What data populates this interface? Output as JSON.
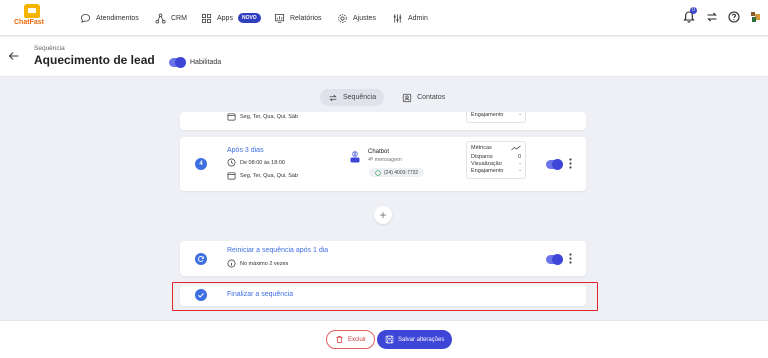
{
  "brand": {
    "name": "ChatFast"
  },
  "nav": {
    "items": [
      {
        "label": "Atendimentos",
        "icon": "chat-bubble-icon"
      },
      {
        "label": "CRM",
        "icon": "network-icon"
      },
      {
        "label": "Apps",
        "icon": "grid-icon",
        "badge": "NOVO"
      },
      {
        "label": "Relatórios",
        "icon": "report-icon"
      },
      {
        "label": "Ajustes",
        "icon": "gear-icon"
      },
      {
        "label": "Admin",
        "icon": "sliders-icon"
      }
    ],
    "notification_count": "0"
  },
  "header": {
    "breadcrumb": "Sequência",
    "title": "Aquecimento de lead",
    "toggle_label": "Habilitada",
    "enabled": true
  },
  "tabs": [
    {
      "label": "Sequência",
      "active": true
    },
    {
      "label": "Contatos",
      "active": false
    }
  ],
  "steps": {
    "partial": {
      "days_text": "Seg, Ter, Qua, Qui, Sáb",
      "metric_label": "Engajamento",
      "metric_value": "-"
    },
    "step4": {
      "number": "4",
      "title": "Após 3 dias",
      "time_text": "De 08:00 às 18:00",
      "days_text": "Seg, Ter, Qua, Qui, Sáb",
      "bot_name": "Chatbot",
      "bot_message": "4ª mensagem",
      "phone": "(24) 4003-7732",
      "metrics": {
        "title": "Métricas",
        "rows": [
          {
            "label": "Disparos",
            "value": "0"
          },
          {
            "label": "Visualização",
            "value": "-"
          },
          {
            "label": "Engajamento",
            "value": "-"
          }
        ]
      },
      "enabled": true
    },
    "restart": {
      "title": "Reiniciar a sequência após 1 dia",
      "limit_text": "No máximo 2 vezes",
      "enabled": true
    },
    "finish": {
      "title": "Finalizar a sequência"
    }
  },
  "add_button": "+",
  "footer": {
    "delete_label": "Excluir",
    "save_label": "Salvar alterações"
  },
  "colors": {
    "accent": "#3d46d6",
    "link": "#3d6fe0",
    "danger": "#d03a3a",
    "highlight": "#e0242a"
  }
}
